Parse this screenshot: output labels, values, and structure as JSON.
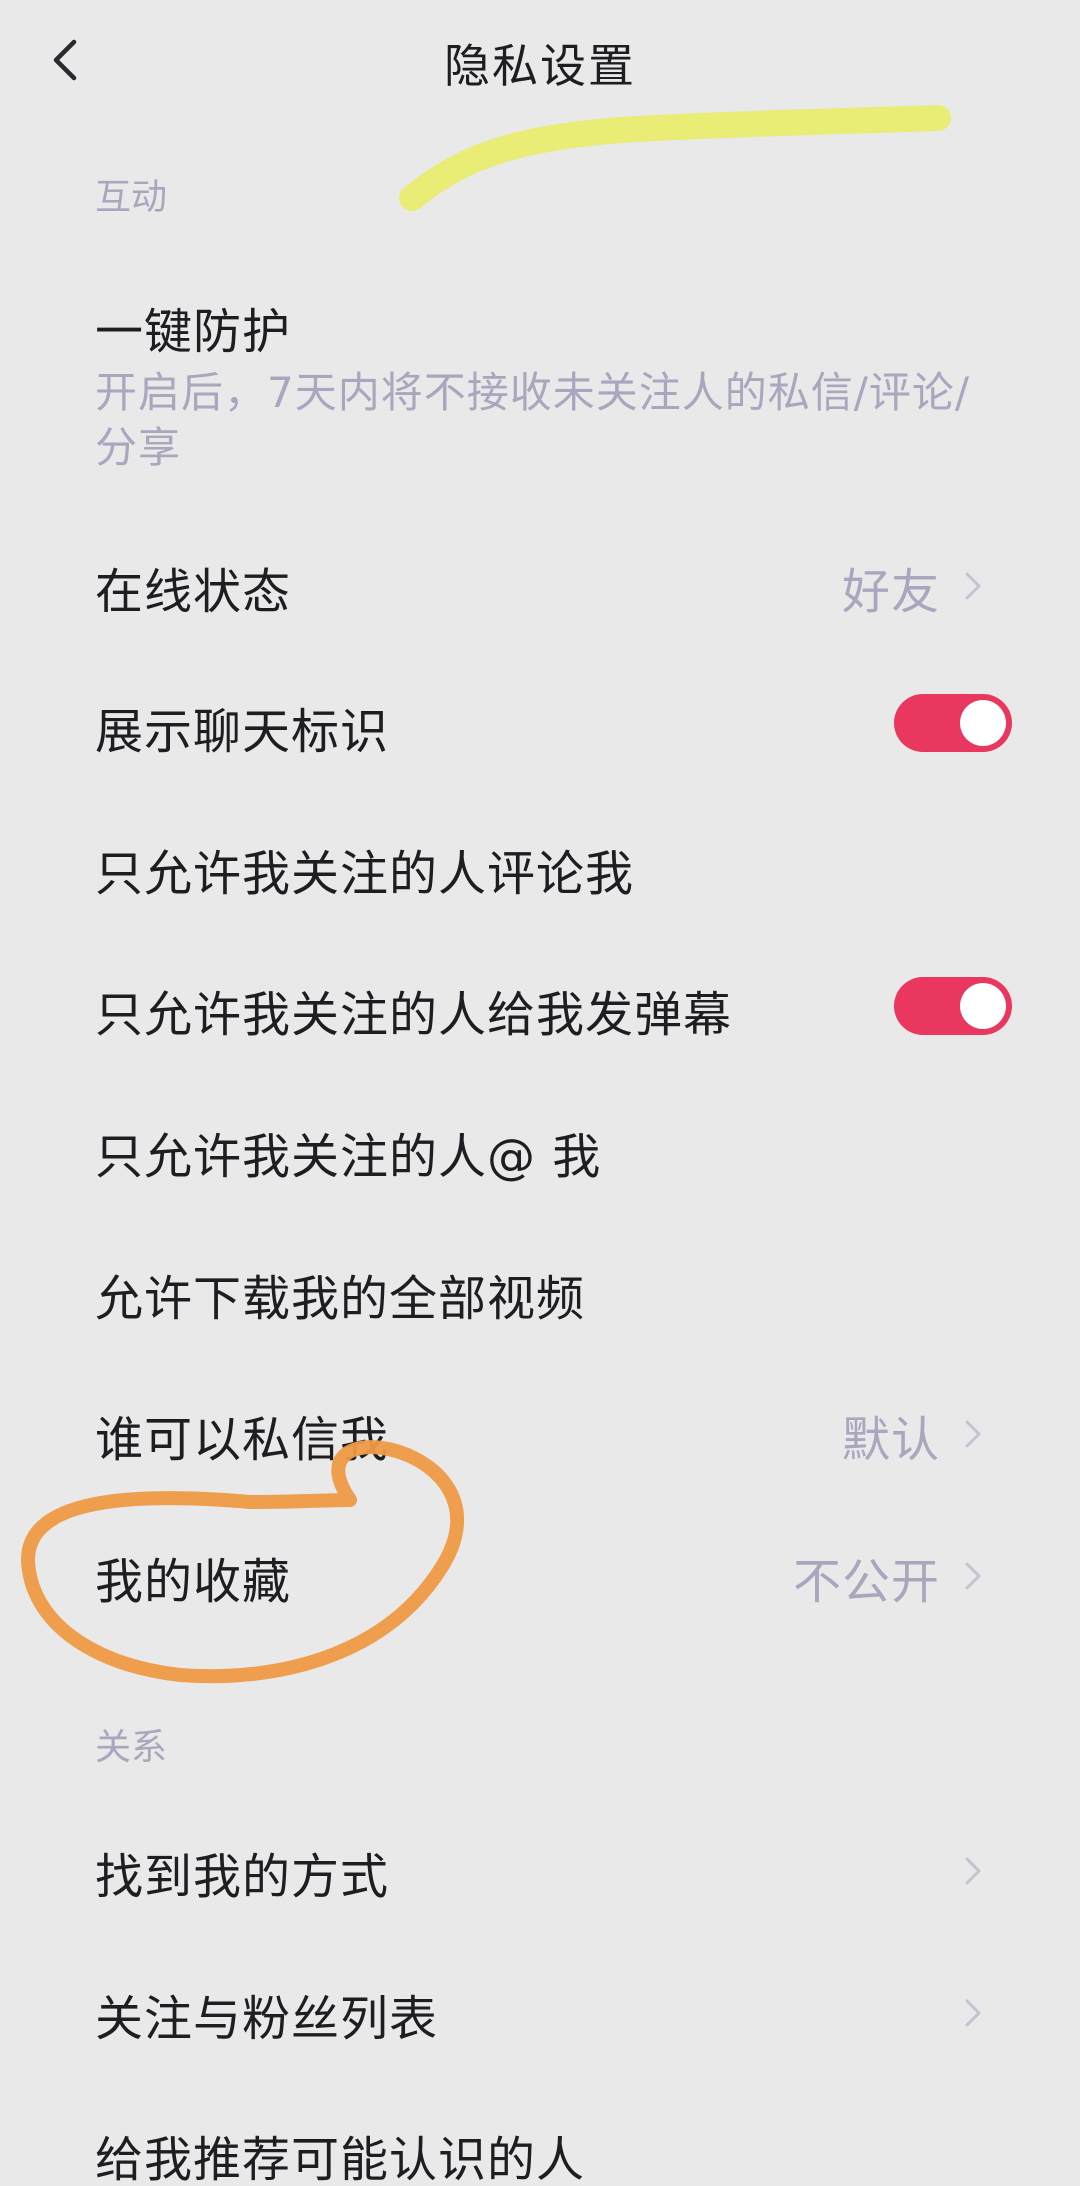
{
  "header": {
    "title": "隐私设置",
    "back_icon": "chevron-left-icon"
  },
  "sections": {
    "interaction": "互动",
    "relationship": "关系"
  },
  "rows": {
    "one_key_protect": {
      "label": "一键防护",
      "description": "开启后，7天内将不接收未关注人的私信/评论/分享"
    },
    "online_status": {
      "label": "在线状态",
      "value": "好友"
    },
    "show_chat_badge": {
      "label": "展示聊天标识",
      "toggle": true
    },
    "only_followed_comment": {
      "label": "只允许我关注的人评论我"
    },
    "only_followed_danmaku": {
      "label": "只允许我关注的人给我发弹幕",
      "toggle": true
    },
    "only_followed_mention": {
      "label": "只允许我关注的人@ 我"
    },
    "allow_download": {
      "label": "允许下载我的全部视频"
    },
    "who_can_message": {
      "label": "谁可以私信我",
      "value": "默认"
    },
    "my_favorites": {
      "label": "我的收藏",
      "value": "不公开"
    },
    "find_me": {
      "label": "找到我的方式"
    },
    "follow_fans_list": {
      "label": "关注与粉丝列表"
    },
    "recommend_people": {
      "label": "给我推荐可能认识的人"
    }
  },
  "colors": {
    "background": "#e9e9ea",
    "text": "#1e1e22",
    "secondary_text": "#a8a7bd",
    "toggle_on": "#e93760",
    "annotation_yellow": "#e8ec6a",
    "annotation_orange": "#ee9a45"
  }
}
